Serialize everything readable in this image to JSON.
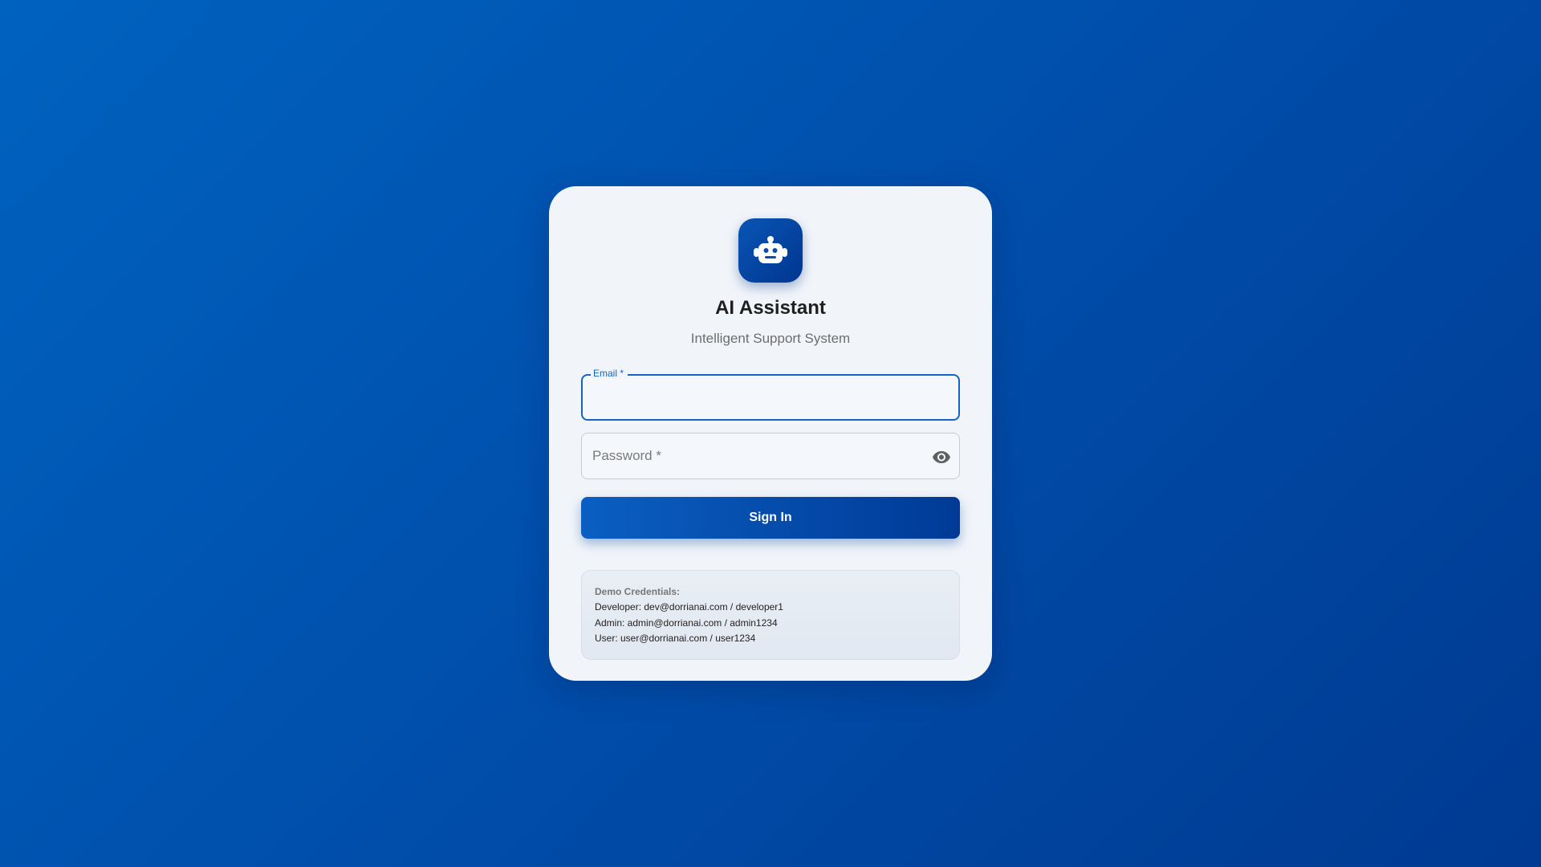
{
  "app": {
    "title": "AI Assistant",
    "subtitle": "Intelligent Support System",
    "logo_icon": "robot-icon"
  },
  "form": {
    "email": {
      "label": "Email *",
      "value": ""
    },
    "password": {
      "label": "Password *",
      "value": "",
      "toggle_icon": "eye-icon"
    },
    "submit_label": "Sign In"
  },
  "demo": {
    "title": "Demo Credentials:",
    "lines": [
      "Developer: dev@dorrianai.com / developer1",
      "Admin: admin@dorrianai.com / admin1234",
      "User: user@dorrianai.com / user1234"
    ]
  },
  "colors": {
    "background": "#0056b3",
    "accent": "#1565c0",
    "button_start": "#0a5fc2",
    "button_end": "#003a96"
  }
}
